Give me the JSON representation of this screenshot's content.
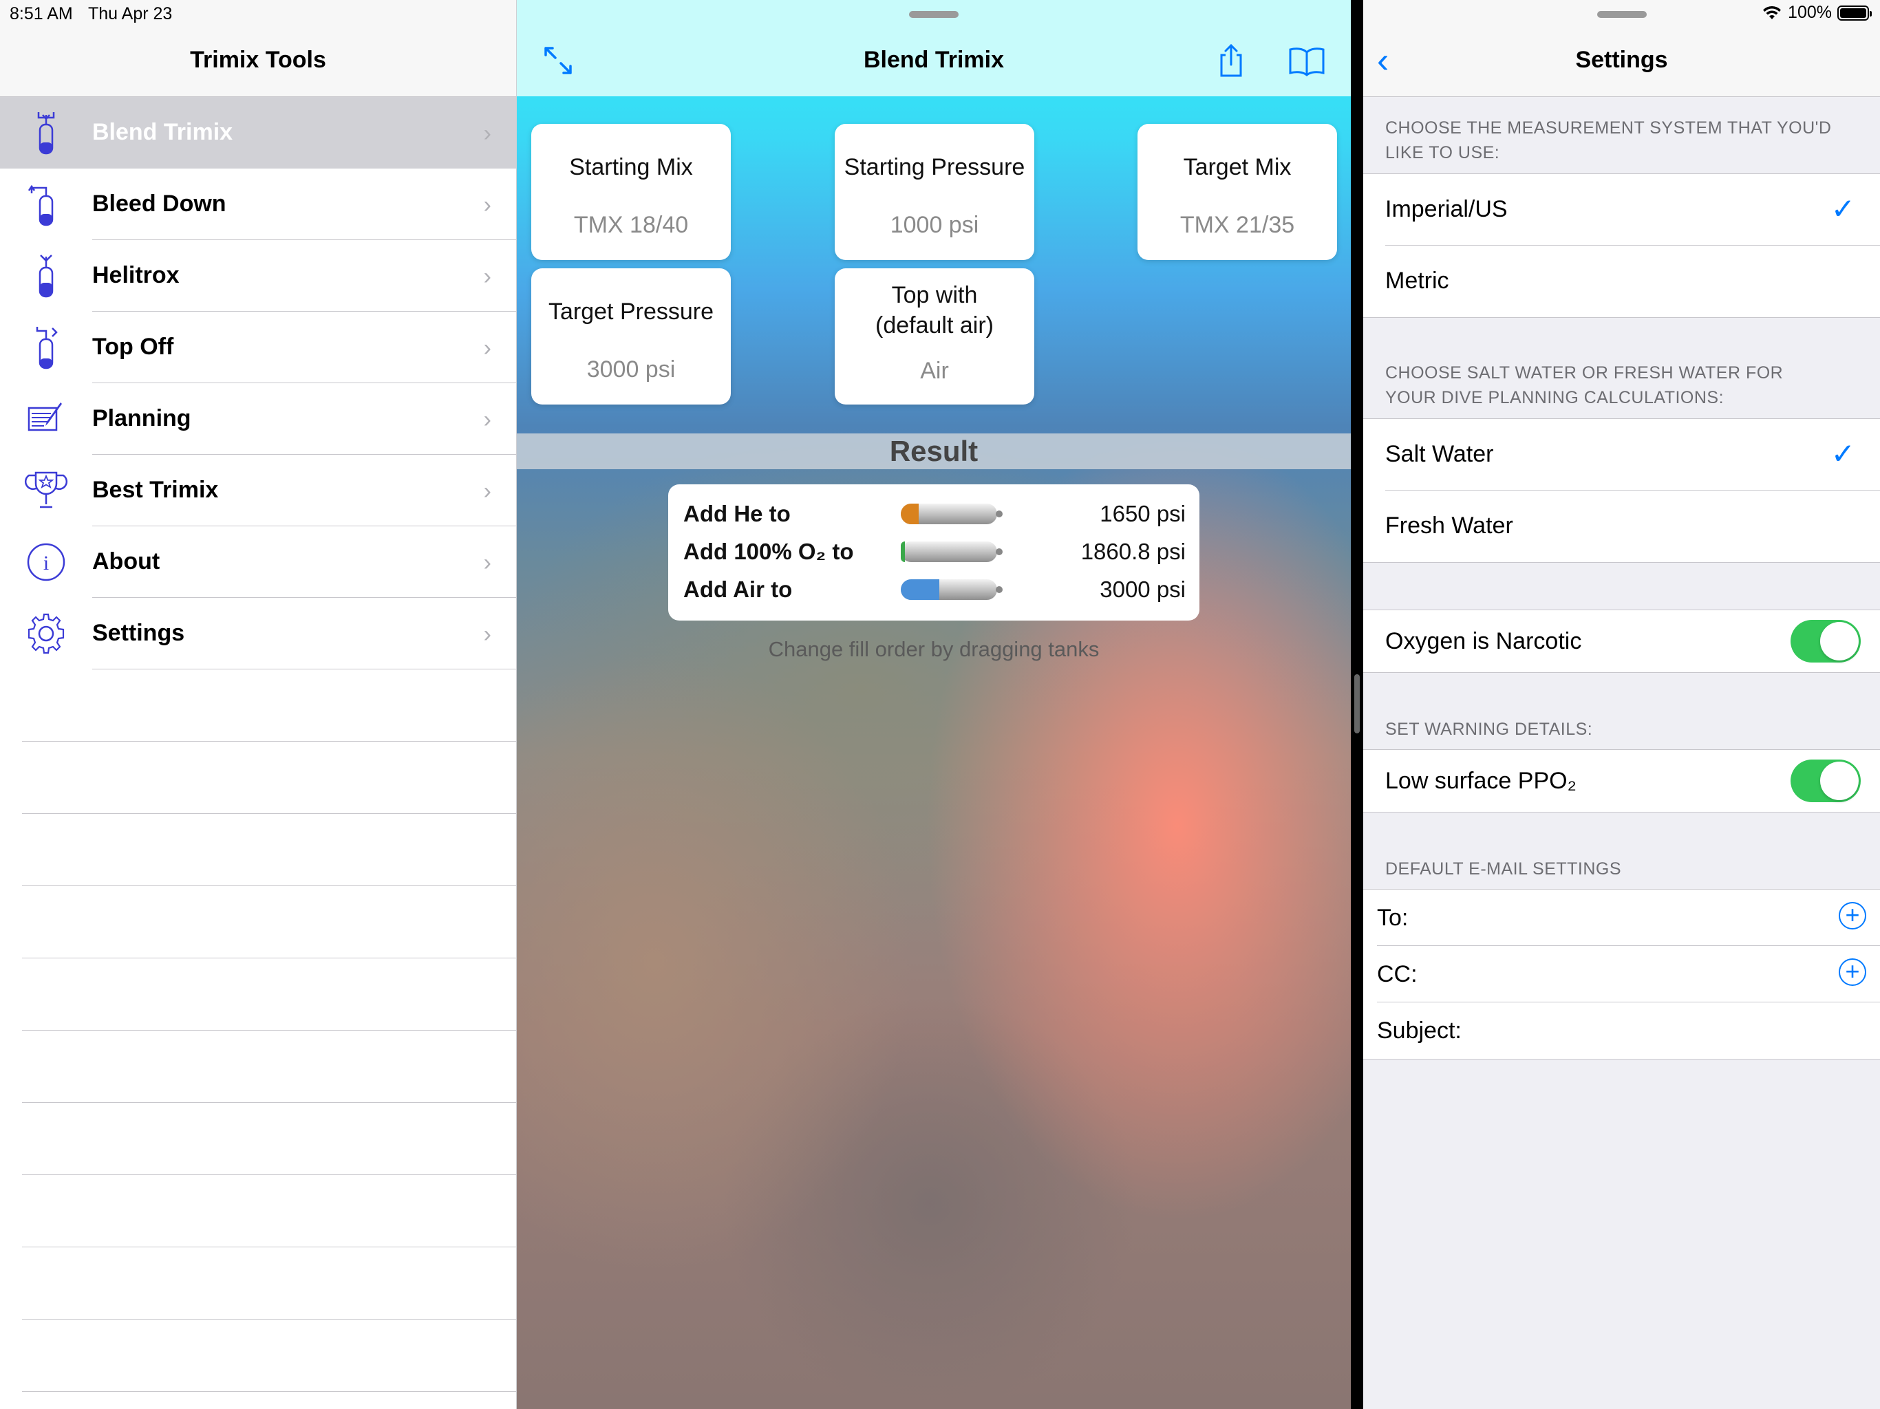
{
  "status_bar": {
    "time": "8:51 AM",
    "date": "Thu Apr 23",
    "battery": "100%"
  },
  "sidebar": {
    "title": "Trimix Tools",
    "items": [
      {
        "label": "Blend Trimix",
        "icon": "blend-tank-icon",
        "selected": true
      },
      {
        "label": "Bleed Down",
        "icon": "bleed-tank-icon"
      },
      {
        "label": "Helitrox",
        "icon": "helitrox-tank-icon"
      },
      {
        "label": "Top Off",
        "icon": "topoff-tank-icon"
      },
      {
        "label": "Planning",
        "icon": "planning-notepad-icon"
      },
      {
        "label": "Best Trimix",
        "icon": "trophy-icon"
      },
      {
        "label": "About",
        "icon": "info-icon"
      },
      {
        "label": "Settings",
        "icon": "gear-icon"
      }
    ]
  },
  "blend": {
    "title": "Blend Trimix",
    "cards": {
      "starting_mix": {
        "title": "Starting Mix",
        "value": "TMX 18/40"
      },
      "starting_pressure": {
        "title": "Starting Pressure",
        "value": "1000 psi"
      },
      "target_mix": {
        "title": "Target Mix",
        "value": "TMX 21/35"
      },
      "target_pressure": {
        "title": "Target Pressure",
        "value": "3000 psi"
      },
      "top_with": {
        "title_line1": "Top with",
        "title_line2": "(default air)",
        "value": "Air"
      }
    },
    "result_title": "Result",
    "results": [
      {
        "label": "Add He to",
        "value": "1650 psi",
        "tank_color": "#d9821e"
      },
      {
        "label": "Add 100% O₂ to",
        "value": "1860.8 psi",
        "tank_color": "#3aa84a"
      },
      {
        "label": "Add Air to",
        "value": "3000 psi",
        "tank_color": "#4a90d9"
      }
    ],
    "hint": "Change fill order by dragging tanks"
  },
  "settings": {
    "title": "Settings",
    "measurement_header": "CHOOSE THE MEASUREMENT SYSTEM THAT YOU'D LIKE TO USE:",
    "imperial": "Imperial/US",
    "metric": "Metric",
    "water_header": "CHOOSE SALT WATER OR FRESH WATER FOR YOUR DIVE PLANNING CALCULATIONS:",
    "salt": "Salt Water",
    "fresh": "Fresh Water",
    "oxygen_narcotic": "Oxygen is Narcotic",
    "warning_header": "SET WARNING DETAILS:",
    "low_ppo2": "Low surface PPO₂",
    "email_header": "DEFAULT E-MAIL SETTINGS",
    "to": "To:",
    "cc": "CC:",
    "subject": "Subject:",
    "accent": "#007aff",
    "toggle_on": "#34c759"
  }
}
